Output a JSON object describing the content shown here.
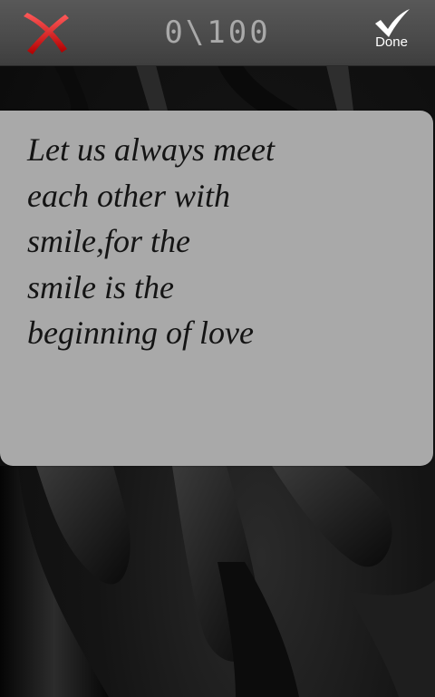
{
  "toolbar": {
    "close_icon": "close-x-icon",
    "counter": "0\\100",
    "done_icon": "checkmark-icon",
    "done_label": "Done"
  },
  "editor": {
    "text": "Let us always meet\neach other with\nsmile,for the\nsmile is the\nbeginning of love"
  },
  "colors": {
    "toolbar_bg": "#4a4a4a",
    "counter_text": "#a9a9a9",
    "card_bg": "#a9a9a9",
    "close_icon_red": "#d01818",
    "background": "#151515"
  }
}
